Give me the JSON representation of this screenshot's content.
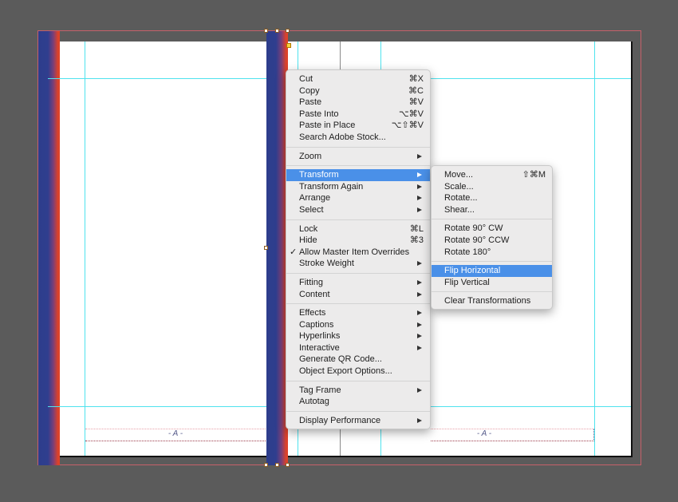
{
  "canvas": {
    "background_color": "#5b5b5b",
    "guide_color": "#4fe3ee",
    "bleed_color": "#c6606a",
    "gradient_colors": [
      "#2d3d8c",
      "#e0412a"
    ]
  },
  "pages": {
    "left": {
      "footer_marker": "- A -"
    },
    "right": {
      "footer_marker": "- A -"
    }
  },
  "context_menu": {
    "groups": [
      [
        {
          "label": "Cut",
          "shortcut": "⌘X"
        },
        {
          "label": "Copy",
          "shortcut": "⌘C"
        },
        {
          "label": "Paste",
          "shortcut": "⌘V"
        },
        {
          "label": "Paste Into",
          "shortcut": "⌥⌘V"
        },
        {
          "label": "Paste in Place",
          "shortcut": "⌥⇧⌘V"
        },
        {
          "label": "Search Adobe Stock..."
        }
      ],
      [
        {
          "label": "Zoom",
          "submenu": true
        }
      ],
      [
        {
          "label": "Transform",
          "submenu": true,
          "highlighted": true
        },
        {
          "label": "Transform Again",
          "submenu": true
        },
        {
          "label": "Arrange",
          "submenu": true
        },
        {
          "label": "Select",
          "submenu": true
        }
      ],
      [
        {
          "label": "Lock",
          "shortcut": "⌘L"
        },
        {
          "label": "Hide",
          "shortcut": "⌘3"
        },
        {
          "label": "Allow Master Item Overrides",
          "checked": true
        },
        {
          "label": "Stroke Weight",
          "submenu": true
        }
      ],
      [
        {
          "label": "Fitting",
          "submenu": true
        },
        {
          "label": "Content",
          "submenu": true
        }
      ],
      [
        {
          "label": "Effects",
          "submenu": true
        },
        {
          "label": "Captions",
          "submenu": true
        },
        {
          "label": "Hyperlinks",
          "submenu": true
        },
        {
          "label": "Interactive",
          "submenu": true
        },
        {
          "label": "Generate QR Code..."
        },
        {
          "label": "Object Export Options..."
        }
      ],
      [
        {
          "label": "Tag Frame",
          "submenu": true
        },
        {
          "label": "Autotag"
        }
      ],
      [
        {
          "label": "Display Performance",
          "submenu": true
        }
      ]
    ],
    "checkmark": "✓"
  },
  "transform_submenu": {
    "groups": [
      [
        {
          "label": "Move...",
          "shortcut": "⇧⌘M"
        },
        {
          "label": "Scale..."
        },
        {
          "label": "Rotate..."
        },
        {
          "label": "Shear..."
        }
      ],
      [
        {
          "label": "Rotate 90° CW"
        },
        {
          "label": "Rotate 90° CCW"
        },
        {
          "label": "Rotate 180°"
        }
      ],
      [
        {
          "label": "Flip Horizontal",
          "highlighted": true
        },
        {
          "label": "Flip Vertical"
        }
      ],
      [
        {
          "label": "Clear Transformations"
        }
      ]
    ]
  }
}
